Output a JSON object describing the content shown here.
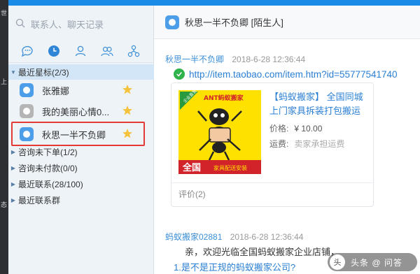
{
  "window": {
    "accent_color": "#1a8be6"
  },
  "desktop_edge": {
    "marks": [
      "世",
      "上",
      "态"
    ]
  },
  "sidebar": {
    "search": {
      "placeholder": "联系人、聊天记录",
      "icon": "search-icon"
    },
    "tab_icons": [
      "chat-icon",
      "recent-clock-icon",
      "contact-icon",
      "group-icon",
      "org-icon"
    ],
    "groups": [
      {
        "label": "最近星标(2/3)",
        "expanded": true
      },
      {
        "label": "咨询未下单(1/2)",
        "expanded": false
      },
      {
        "label": "咨询未付款(0/0)",
        "expanded": false
      },
      {
        "label": "最近联系(28/100)",
        "expanded": false
      },
      {
        "label": "最近联系群",
        "expanded": false
      }
    ],
    "starred": [
      {
        "name": "张雅娜",
        "avatar_color": "#4d9ee8",
        "starred": true
      },
      {
        "name": "我的美丽心情0...",
        "avatar_color": "#b5b5b5",
        "starred": true
      },
      {
        "name": "秋思一半不负卿",
        "avatar_color": "#4d9ee8",
        "starred": true
      }
    ]
  },
  "chat": {
    "header_title": "秋思一半不负卿 [陌生人]",
    "message1": {
      "sender": "秋思一半不负卿",
      "time": "2018-6-28 12:36:44",
      "url": "http://item.taobao.com/item.htm?id=55777541740"
    },
    "product": {
      "title": "【蚂蚁搬家】 全国同城上门家具拆装打包搬运",
      "price_label": "价格:",
      "price": "¥ 10.00",
      "shipping_label": "运费:",
      "shipping": "卖家承担运费",
      "reviews": "评价(2)",
      "thumb": {
        "brand": "ANT蚂蚁搬家",
        "badge": "企业直营",
        "footer_left": "全国",
        "footer_right": "家具配送安装"
      }
    },
    "message2": {
      "sender": "蚂蚁搬家02881",
      "time": "2018-6-28 12:36:44",
      "greeting": "亲，欢迎光临全国蚂蚁搬家企业店铺，",
      "question": "1.是不是正规的蚂蚁搬家公司?"
    }
  },
  "watermark": {
    "text": "头条 @ 问答",
    "logo": "头"
  }
}
